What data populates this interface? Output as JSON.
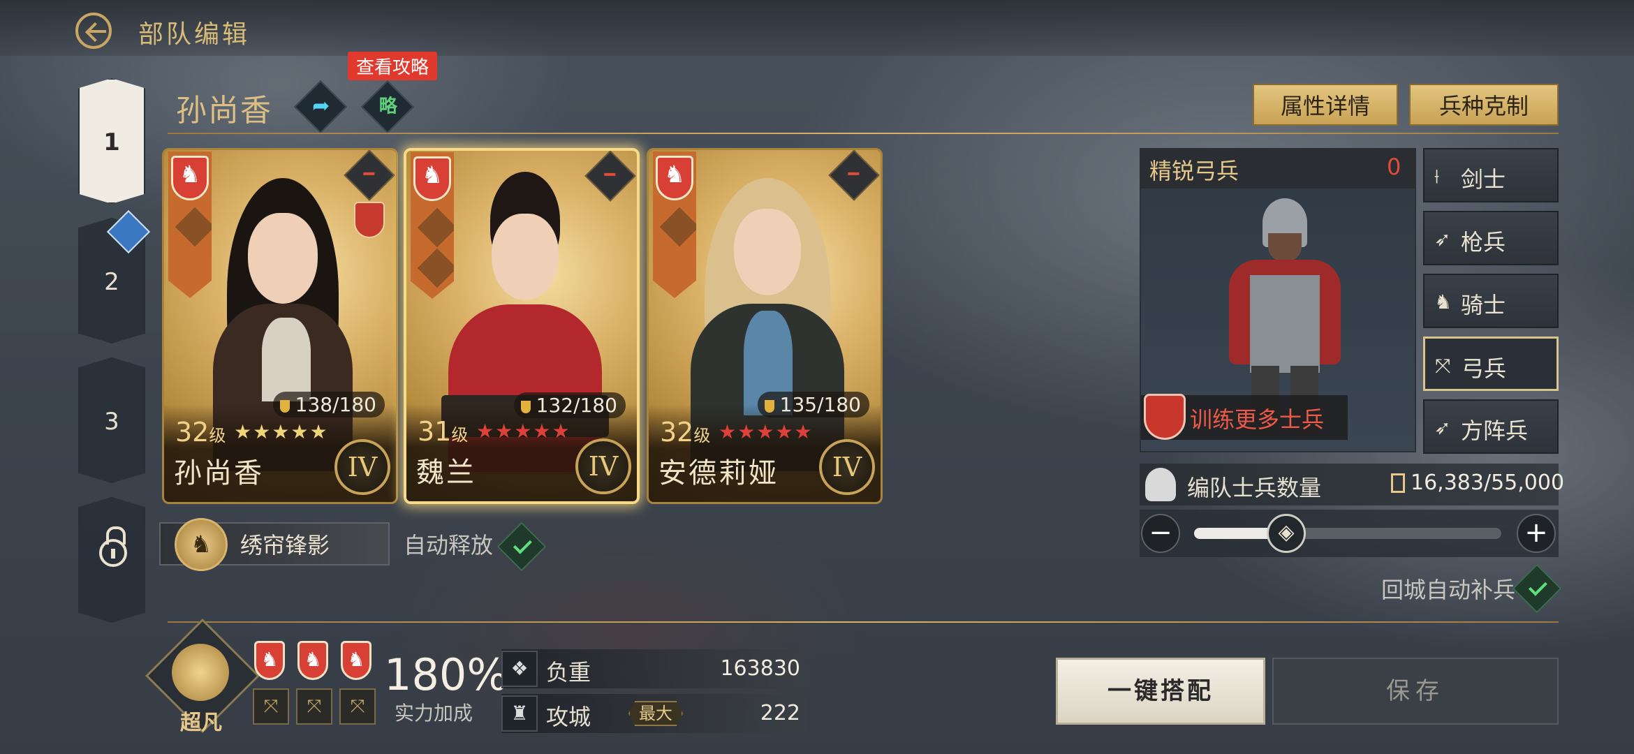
{
  "header": {
    "title": "部队编辑"
  },
  "slots": [
    {
      "label": "1"
    },
    {
      "label": "2"
    },
    {
      "label": "3"
    }
  ],
  "hero_header": {
    "name": "孙尚香",
    "guide_tip": "查看攻略",
    "guide_icon_text": "略",
    "share_icon_text": "➦",
    "buttons": {
      "attributes": "属性详情",
      "counters": "兵种克制"
    }
  },
  "cards": [
    {
      "name": "孙尚香",
      "level": "32",
      "level_unit": "级",
      "stamina": "138/180",
      "tier": "IV",
      "stars": 5,
      "star_color": "#f0d47a"
    },
    {
      "name": "魏兰",
      "level": "31",
      "level_unit": "级",
      "stamina": "132/180",
      "tier": "IV",
      "stars": 5,
      "star_color": "#e0403a"
    },
    {
      "name": "安德莉娅",
      "level": "32",
      "level_unit": "级",
      "stamina": "135/180",
      "tier": "IV",
      "stars": 5,
      "star_color": "#e0403a"
    }
  ],
  "skill": {
    "name": "绣帘锋影",
    "auto_label": "自动释放"
  },
  "troop": {
    "title": "精锐弓兵",
    "count": "0",
    "train_label": "训练更多士兵",
    "types": [
      {
        "icon": "⟊",
        "label": "剑士"
      },
      {
        "icon": "➶",
        "label": "枪兵"
      },
      {
        "icon": "♞",
        "label": "骑士"
      },
      {
        "icon": "⤧",
        "label": "弓兵"
      },
      {
        "icon": "➶",
        "label": "方阵兵"
      }
    ],
    "count_label": "编队士兵数量",
    "count_value": "16,383/55,000",
    "slider_fraction": 0.3,
    "auto_refill": "回城自动补兵"
  },
  "bottom": {
    "rank": "超凡",
    "power": "180%",
    "power_label": "实力加成",
    "load_label": "负重",
    "load_value": "163830",
    "siege_label": "攻城",
    "siege_tag": "最大",
    "siege_value": "222",
    "onekey_label": "一键搭配",
    "save_label": "保存"
  }
}
